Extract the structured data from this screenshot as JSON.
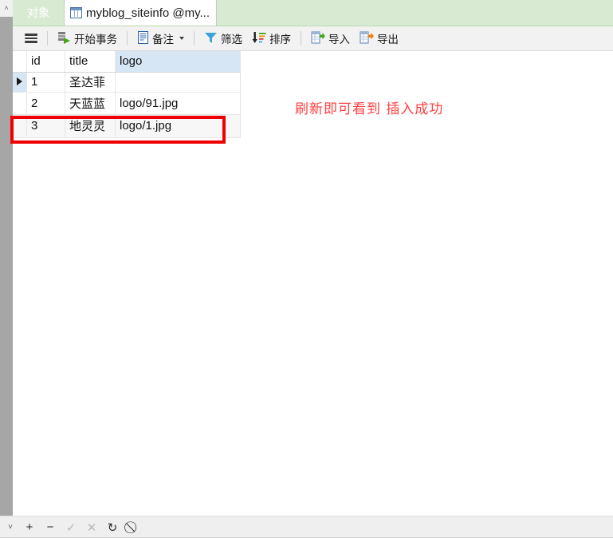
{
  "window": {
    "tabs": [
      {
        "label": "对象",
        "icon": "",
        "active": false,
        "name": "tab-objects"
      },
      {
        "label": "myblog_siteinfo @my...",
        "icon": "table-grid-icon",
        "active": true,
        "name": "tab-table-myblog-siteinfo"
      }
    ]
  },
  "toolbar": {
    "menu_icon": "hamburger-menu-icon",
    "items": [
      {
        "label": "开始事务",
        "icon": "begin-transaction-icon",
        "caret": false
      },
      {
        "label": "备注",
        "icon": "note-icon",
        "caret": true
      },
      {
        "label": "筛选",
        "icon": "filter-funnel-icon",
        "caret": false
      },
      {
        "label": "排序",
        "icon": "sort-descending-icon",
        "caret": false
      },
      {
        "label": "导入",
        "icon": "import-icon",
        "caret": false
      },
      {
        "label": "导出",
        "icon": "export-icon",
        "caret": false
      }
    ]
  },
  "grid": {
    "columns": [
      "id",
      "title",
      "logo"
    ],
    "selected_column": "logo",
    "current_row_index": 0,
    "rows": [
      {
        "id": "1",
        "title": "圣达菲",
        "logo": ""
      },
      {
        "id": "2",
        "title": "天蓝蓝",
        "logo": "logo/91.jpg"
      },
      {
        "id": "3",
        "title": "地灵灵",
        "logo": "logo/1.jpg"
      }
    ]
  },
  "annotation": {
    "text": "刷新即可看到 插入成功",
    "color": "#ff4040",
    "highlight_box_color": "#ee0000"
  },
  "statusbar": {
    "buttons": [
      {
        "label": "˅",
        "name": "collapse-chevron-icon",
        "enabled": true
      },
      {
        "label": "+",
        "name": "add-record-button",
        "enabled": true
      },
      {
        "label": "−",
        "name": "delete-record-button",
        "enabled": true
      },
      {
        "label": "✓",
        "name": "apply-changes-button",
        "enabled": false
      },
      {
        "label": "✕",
        "name": "cancel-changes-button",
        "enabled": false
      },
      {
        "label": "↻",
        "name": "refresh-button",
        "enabled": true
      },
      {
        "label": "⃠",
        "name": "stop-button",
        "enabled": true
      }
    ]
  },
  "scrollbar": {
    "up_arrow": "˄",
    "down_arrow": "˅"
  }
}
